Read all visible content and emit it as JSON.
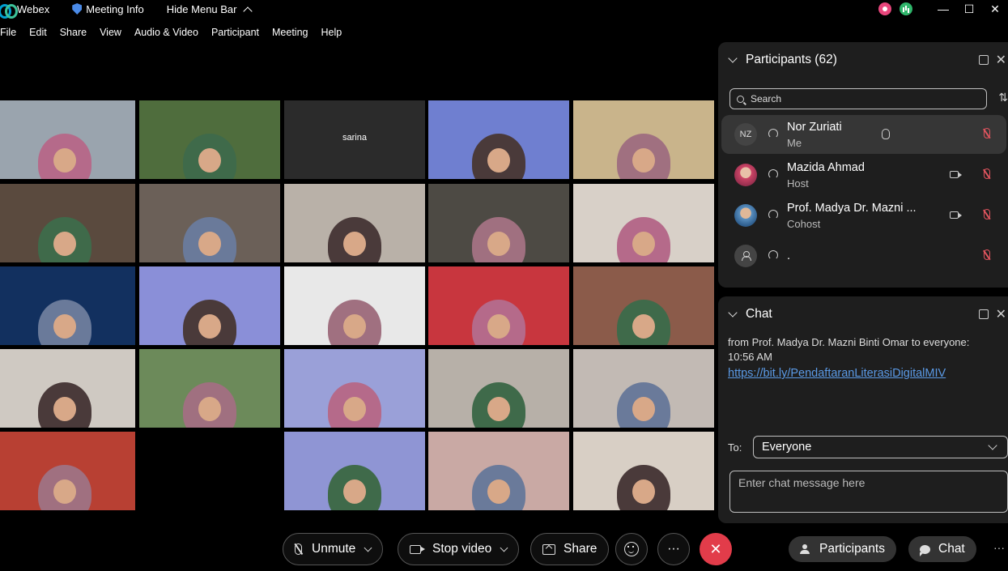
{
  "titlebar": {
    "app_name": "Webex",
    "meeting_info": "Meeting Info",
    "hide_menu_bar": "Hide Menu Bar",
    "minimize": "—",
    "maximize": "☐",
    "close": "✕"
  },
  "menu": [
    "File",
    "Edit",
    "Share",
    "View",
    "Audio & Video",
    "Participant",
    "Meeting",
    "Help"
  ],
  "grid": {
    "tile_colors": [
      [
        "#9aa4ae",
        "#4f6d3d",
        "#2b2b2b",
        "#6f7fd0",
        "#c9b48b"
      ],
      [
        "#5a4a3e",
        "#6b6058",
        "#b9b1a8",
        "#4d4a44",
        "#d8d0c8"
      ],
      [
        "#12305f",
        "#8a8fd8",
        "#e8e8e8",
        "#c8363e",
        "#8b5b4a"
      ],
      [
        "#cfc9c2",
        "#6c8a5a",
        "#9aa0d8",
        "#b7b0a8",
        "#c2bab4"
      ],
      [
        "#b84033",
        "#000000",
        "#8f95d4",
        "#c9a9a4",
        "#d8cfc5"
      ]
    ],
    "sarina_label": "sarina"
  },
  "participants_panel": {
    "title": "Participants (62)",
    "search_placeholder": "Search",
    "participants": [
      {
        "initials": "NZ",
        "name": "Nor Zuriati",
        "role": "Me"
      },
      {
        "name": "Mazida Ahmad",
        "role": "Host"
      },
      {
        "name": "Prof. Madya Dr. Mazni ...",
        "role": "Cohost"
      },
      {
        "name": ".",
        "role": ""
      }
    ]
  },
  "chat_panel": {
    "title": "Chat",
    "message_header": "from Prof. Madya Dr. Mazni Binti Omar to everyone:",
    "message_time": "10:56 AM",
    "message_link": "https://bit.ly/PendaftaranLiterasiDigitalMIV",
    "to_label": "To:",
    "to_value": "Everyone",
    "input_placeholder": "Enter chat message here"
  },
  "controls": {
    "unmute": "Unmute",
    "stop_video": "Stop video",
    "share": "Share",
    "more": "···",
    "end": "✕",
    "participants": "Participants",
    "chat": "Chat",
    "more_right": "···"
  },
  "colors": {
    "end_call": "#e23c4a",
    "link": "#5b9ae6",
    "mute_red": "#e0545e"
  }
}
